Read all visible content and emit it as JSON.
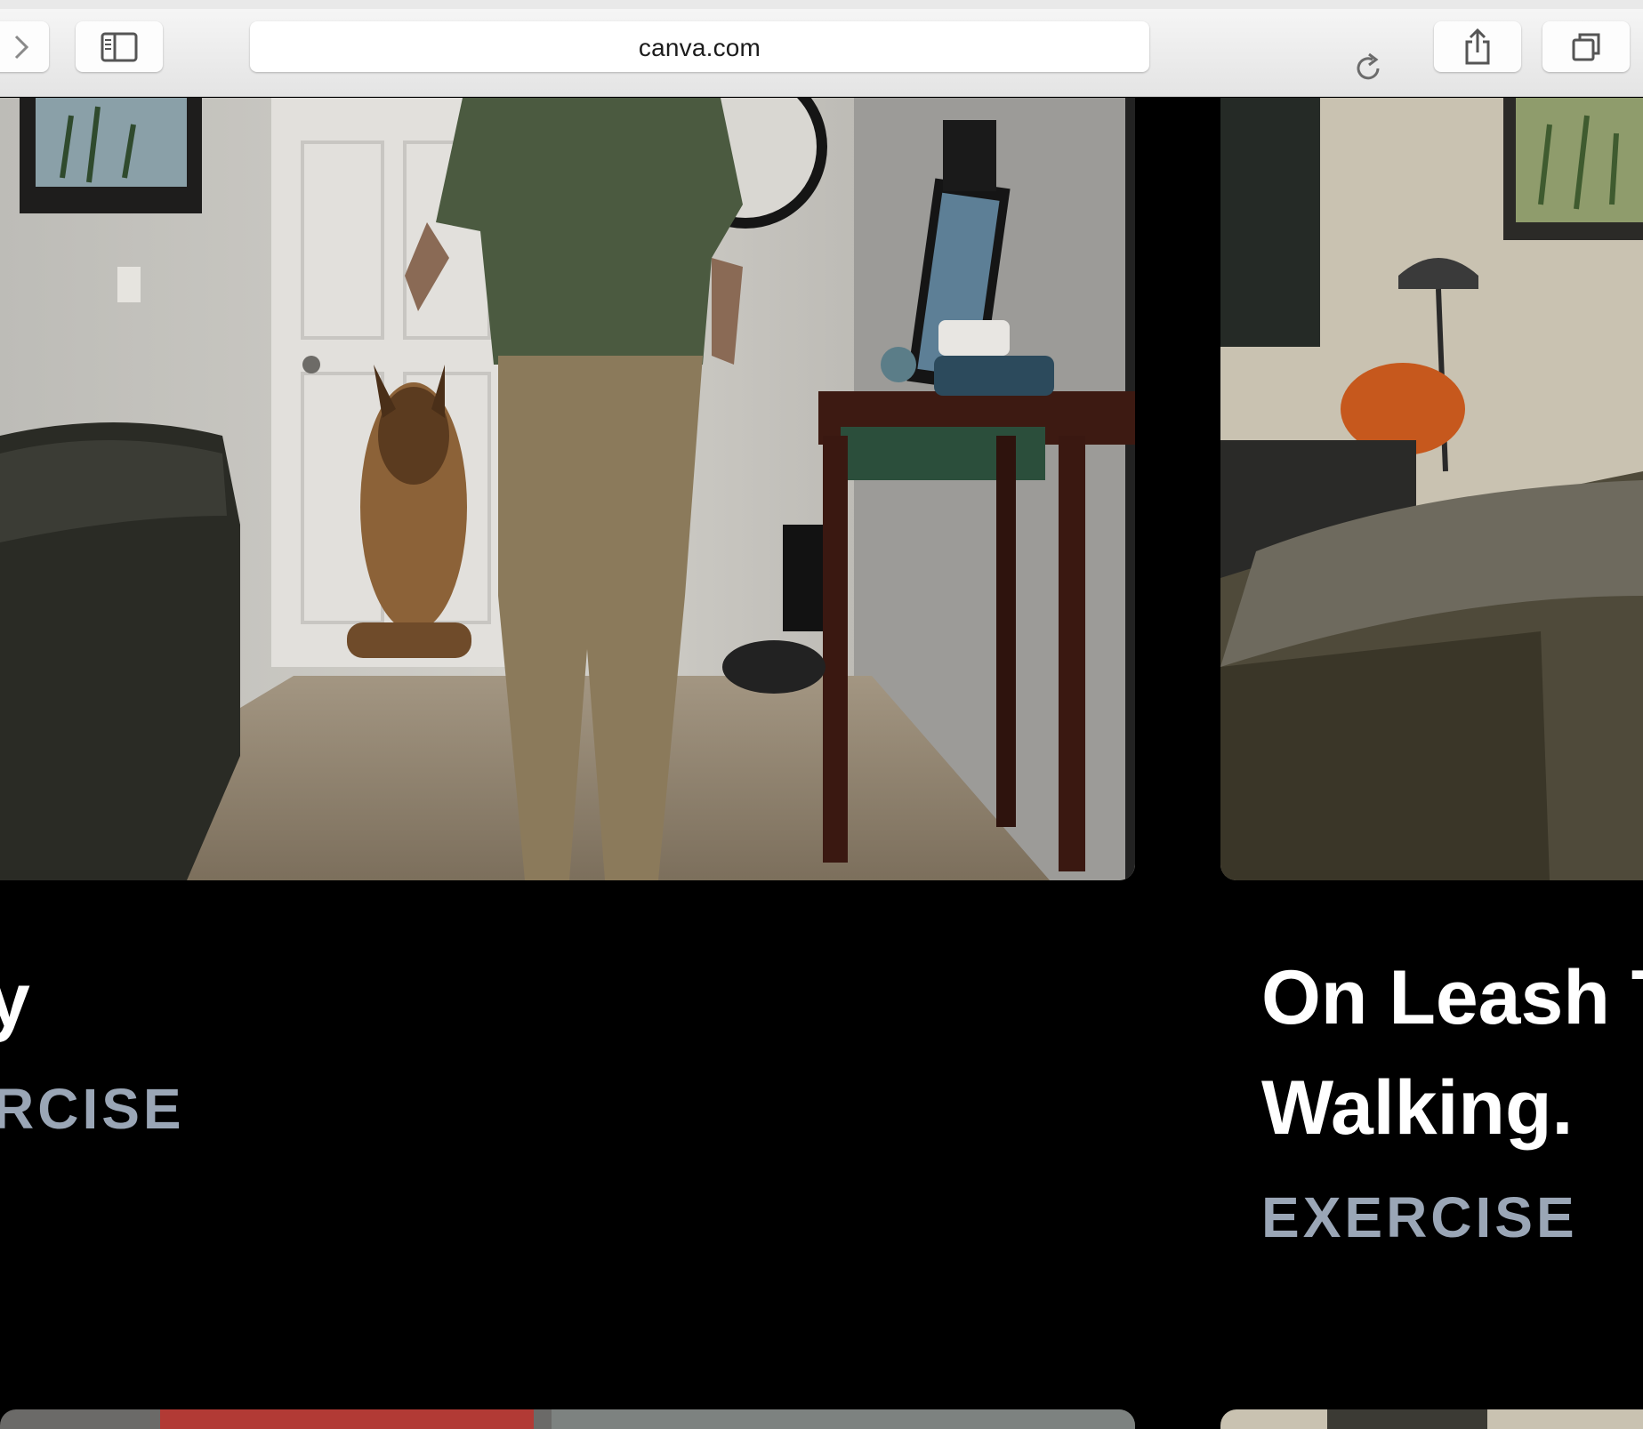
{
  "browser": {
    "url": "canva.com",
    "icons": {
      "forward": "chevron-right-icon",
      "sidebar": "sidebar-icon",
      "reload": "reload-icon",
      "share": "share-icon",
      "tabs": "tabs-icon"
    }
  },
  "cards": [
    {
      "title_line1": "y",
      "category": "RCISE"
    },
    {
      "title_line1": "On Leash T",
      "title_line2": "Walking.",
      "category": "EXERCISE"
    }
  ],
  "colors": {
    "background": "#000000",
    "title": "#ffffff",
    "category": "#9aa6b6",
    "toolbar": "#efefef"
  }
}
